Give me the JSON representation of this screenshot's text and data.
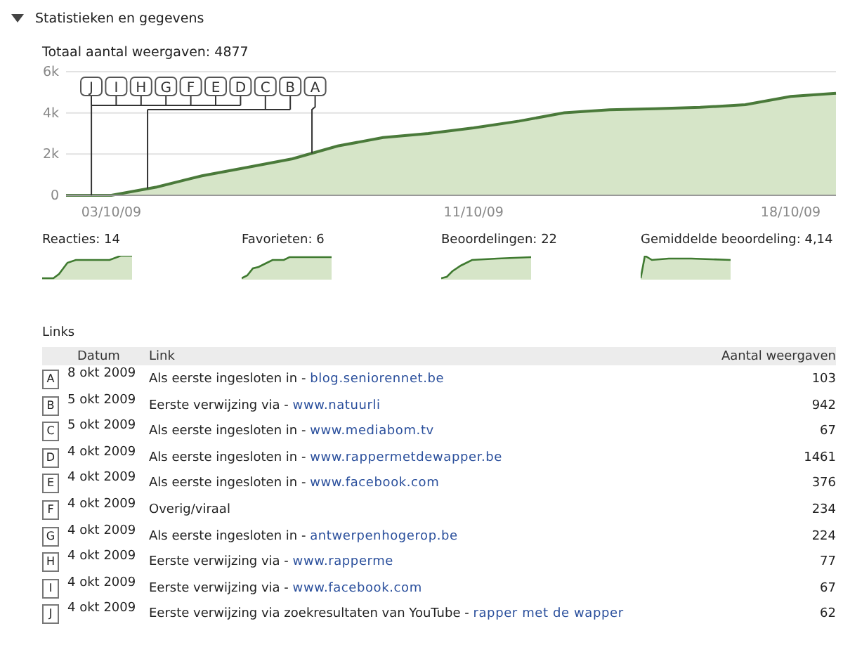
{
  "section": {
    "title": "Statistieken en gegevens",
    "expanded": true
  },
  "total": "Totaal aantal weergaven: 4877",
  "chart": {
    "chart_data": {
      "type": "area",
      "categories": [
        null,
        "03/10/09",
        null,
        null,
        null,
        null,
        null,
        null,
        null,
        "11/10/09",
        null,
        null,
        null,
        null,
        null,
        null,
        "18/10/09",
        null
      ],
      "series": [
        {
          "color": "#4a7a3a",
          "values": [
            0,
            0,
            400,
            950,
            1360,
            1770,
            2390,
            2800,
            3000,
            3270,
            3600,
            4000,
            4150,
            4200,
            4270,
            4400,
            4800,
            4950
          ]
        }
      ],
      "ylim": [
        0,
        6000
      ],
      "yticks": [
        {
          "value": 0,
          "label": "0"
        },
        {
          "value": 2000,
          "label": "2k"
        },
        {
          "value": 4000,
          "label": "4k"
        },
        {
          "value": 6000,
          "label": "6k"
        }
      ],
      "annotations": [
        "J",
        "I",
        "H",
        "G",
        "F",
        "E",
        "D",
        "C",
        "B",
        "A"
      ]
    }
  },
  "stats": [
    {
      "label": "Reacties: 14"
    },
    {
      "label": "Favorieten: 6"
    },
    {
      "label": "Beoordelingen: 22"
    },
    {
      "label": "Gemiddelde beoordeling: 4,14"
    }
  ],
  "links": {
    "title": "Links",
    "columns": [
      "Datum",
      "Link",
      "Aantal weergaven"
    ],
    "rows": [
      {
        "marker": "A",
        "date": "8 okt 2009",
        "text": "Als eerste ingesloten in - ",
        "url": "blog.seniorennet.be",
        "views": "103"
      },
      {
        "marker": "B",
        "date": "5 okt 2009",
        "text": "Eerste verwijzing via - ",
        "url": "www.natuurli",
        "views": "942"
      },
      {
        "marker": "C",
        "date": "5 okt 2009",
        "text": "Als eerste ingesloten in - ",
        "url": "www.mediabom.tv",
        "views": "67"
      },
      {
        "marker": "D",
        "date": "4 okt 2009",
        "text": "Als eerste ingesloten in - ",
        "url": "www.rappermetdewapper.be",
        "views": "1461"
      },
      {
        "marker": "E",
        "date": "4 okt 2009",
        "text": "Als eerste ingesloten in - ",
        "url": "www.facebook.com",
        "views": "376"
      },
      {
        "marker": "F",
        "date": "4 okt 2009",
        "text": "Overig/viraal",
        "views": "234"
      },
      {
        "marker": "G",
        "date": "4 okt 2009",
        "text": "Als eerste ingesloten in - ",
        "url": "antwerpenhogerop.be",
        "views": "224"
      },
      {
        "marker": "H",
        "date": "4 okt 2009",
        "text": "Eerste verwijzing via - ",
        "url": "www.rapperme",
        "views": "77"
      },
      {
        "marker": "I",
        "date": "4 okt 2009",
        "text": "Eerste verwijzing via - ",
        "url": "www.facebook.com",
        "views": "67"
      },
      {
        "marker": "J",
        "date": "4 okt 2009",
        "text": "Eerste verwijzing via zoekresultaten van YouTube - ",
        "url": "rapper met de wapper",
        "views": "62"
      }
    ]
  }
}
